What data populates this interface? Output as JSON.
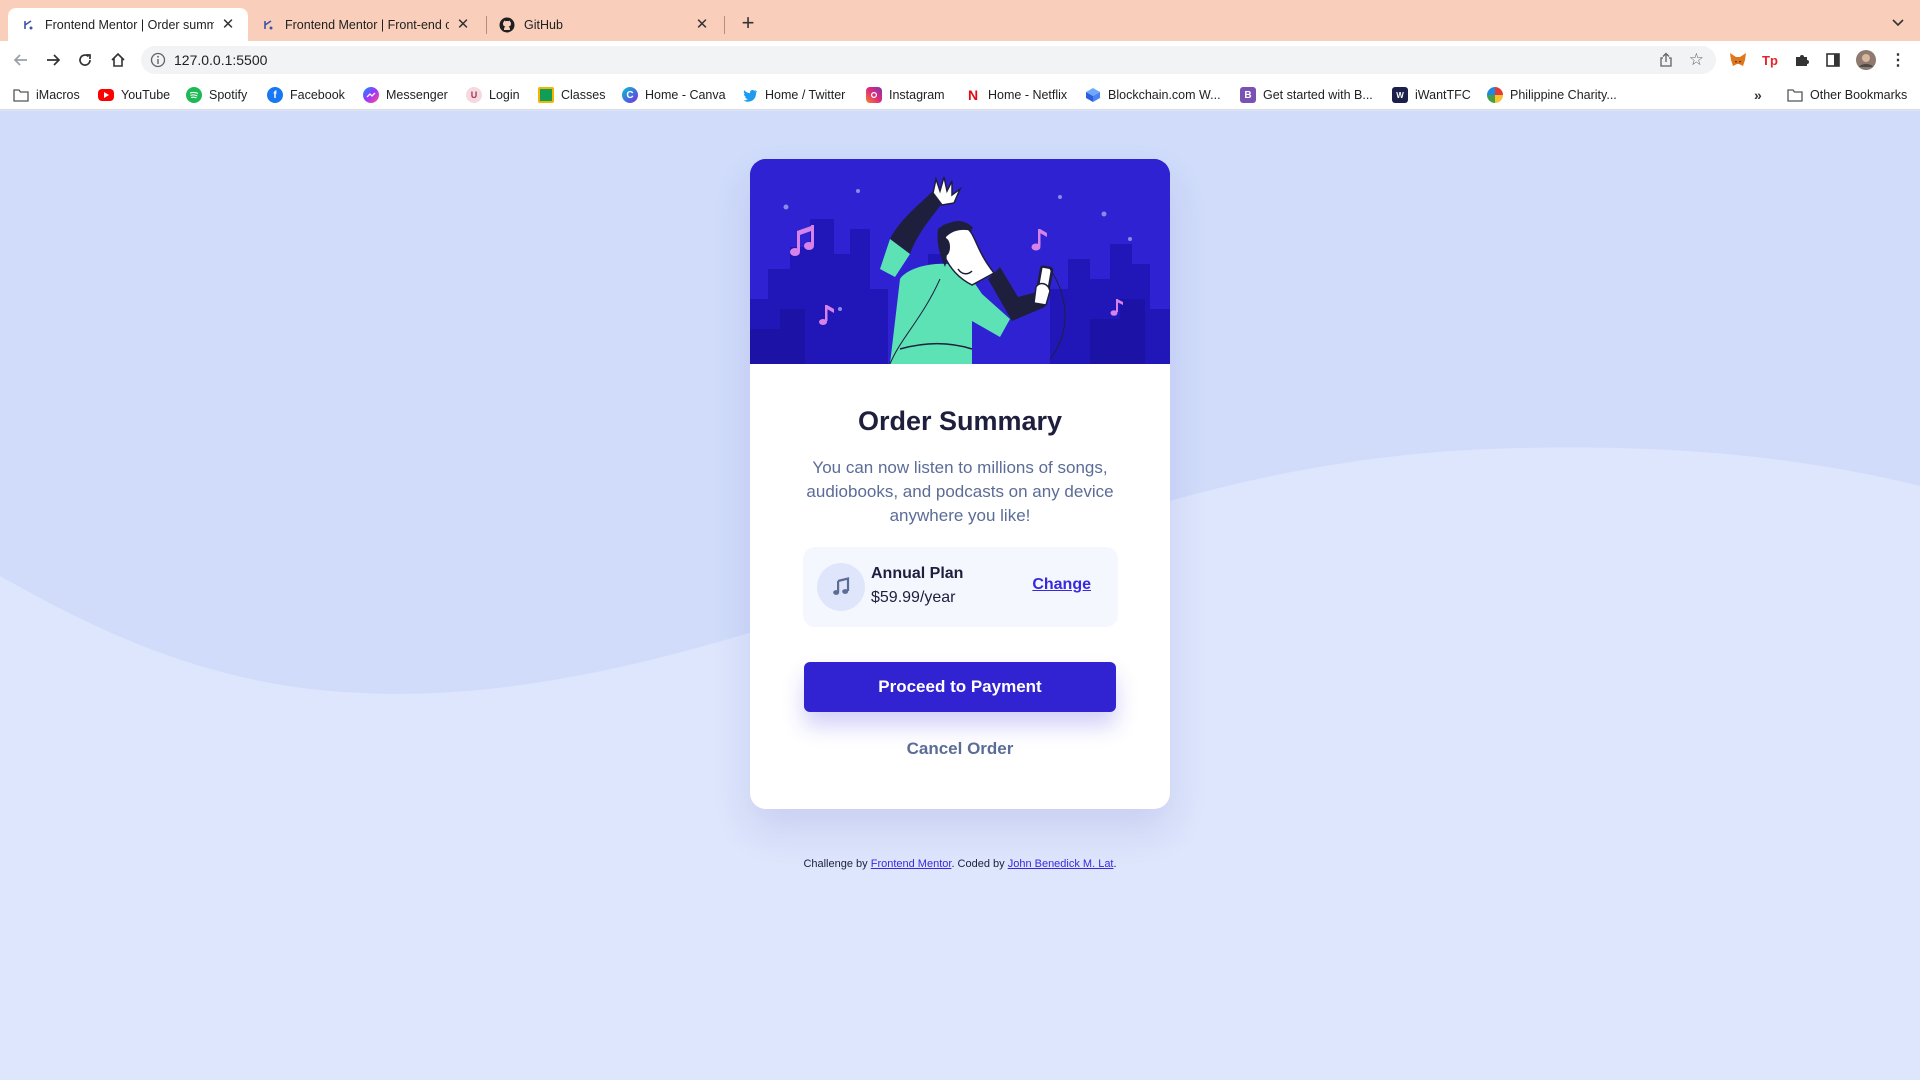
{
  "browser": {
    "tabs": [
      {
        "title": "Frontend Mentor | Order summ",
        "active": true
      },
      {
        "title": "Frontend Mentor | Front-end c",
        "active": false
      },
      {
        "title": "GitHub",
        "active": false
      }
    ],
    "url": "127.0.0.1:5500",
    "bookmarks": [
      {
        "label": "iMacros",
        "icon": "folder-icon"
      },
      {
        "label": "YouTube",
        "icon": "youtube-icon"
      },
      {
        "label": "Spotify",
        "icon": "spotify-icon"
      },
      {
        "label": "Facebook",
        "icon": "facebook-icon"
      },
      {
        "label": "Messenger",
        "icon": "messenger-icon"
      },
      {
        "label": "Login",
        "icon": "login-icon"
      },
      {
        "label": "Classes",
        "icon": "classroom-icon"
      },
      {
        "label": "Home - Canva",
        "icon": "canva-icon"
      },
      {
        "label": "Home / Twitter",
        "icon": "twitter-icon"
      },
      {
        "label": "Instagram",
        "icon": "instagram-icon"
      },
      {
        "label": "Home - Netflix",
        "icon": "netflix-icon"
      },
      {
        "label": "Blockchain.com W...",
        "icon": "blockchain-icon"
      },
      {
        "label": "Get started with B...",
        "icon": "bootstrap-icon"
      },
      {
        "label": "iWantTFC",
        "icon": "iwanttfc-icon"
      },
      {
        "label": "Philippine Charity...",
        "icon": "pcso-icon"
      }
    ],
    "more_bookmarks": "»",
    "other_bookmarks": "Other Bookmarks"
  },
  "card": {
    "title": "Order Summary",
    "description": "You can now listen to millions of songs, audiobooks, and podcasts on any device anywhere you like!",
    "plan": {
      "name": "Annual Plan",
      "price": "$59.99/year",
      "change_label": "Change"
    },
    "pay_label": "Proceed to Payment",
    "cancel_label": "Cancel Order"
  },
  "attribution": {
    "prefix": "Challenge by",
    "link1": "Frontend Mentor",
    "middle": ". Coded by",
    "link2": "John Benedick M. Lat",
    "suffix": "."
  },
  "colors": {
    "background": "#dbe4fb",
    "bright_blue": "#3829e0",
    "desaturated_blue": "#5b6c97",
    "dark_blue": "#1e1f3d",
    "tab_strip": "#f9cfbb"
  }
}
